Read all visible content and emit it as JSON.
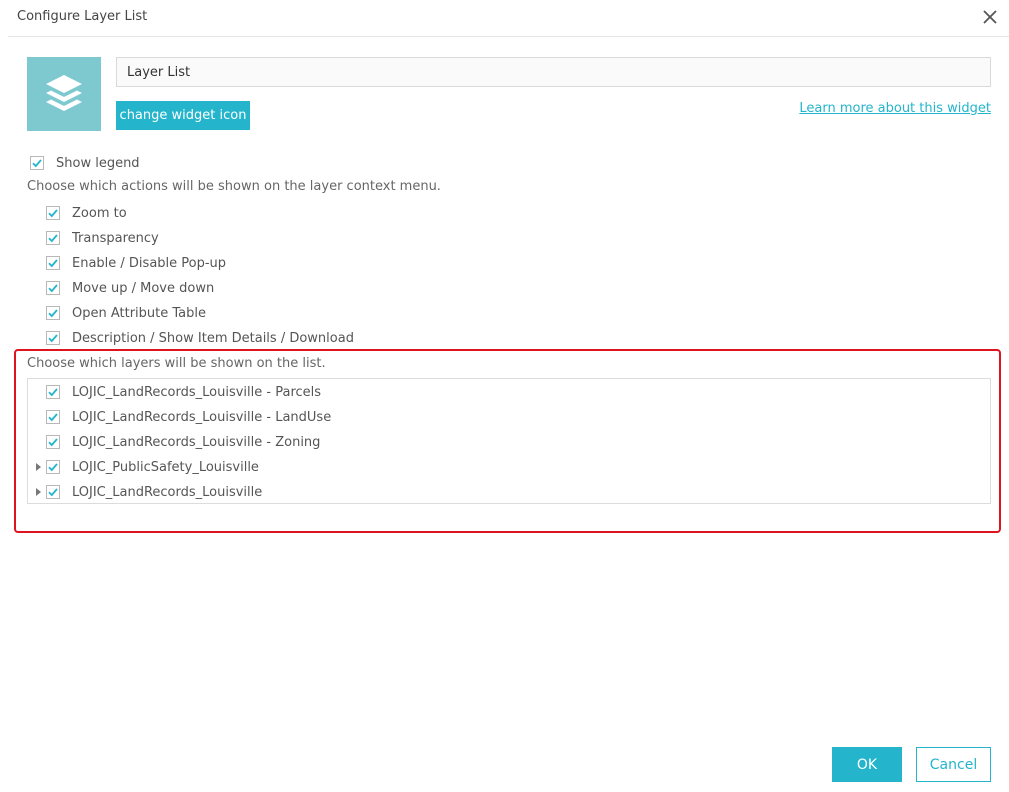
{
  "dialog": {
    "title": "Configure Layer List",
    "close_icon": "close-icon"
  },
  "widget": {
    "icon": "layers-icon",
    "name_value": "Layer List",
    "change_icon_label": "change widget icon",
    "learn_more_label": "Learn more about this widget"
  },
  "options": {
    "show_legend": {
      "label": "Show legend",
      "checked": true
    },
    "actions_heading": "Choose which actions will be shown on the layer context menu.",
    "actions": [
      {
        "label": "Zoom to",
        "checked": true
      },
      {
        "label": "Transparency",
        "checked": true
      },
      {
        "label": "Enable / Disable Pop-up",
        "checked": true
      },
      {
        "label": "Move up / Move down",
        "checked": true
      },
      {
        "label": "Open Attribute Table",
        "checked": true
      },
      {
        "label": "Description / Show Item Details / Download",
        "checked": true
      }
    ]
  },
  "layers": {
    "heading": "Choose which layers will be shown on the list.",
    "items": [
      {
        "label": "LOJIC_LandRecords_Louisville - Parcels",
        "checked": true,
        "expandable": false
      },
      {
        "label": "LOJIC_LandRecords_Louisville - LandUse",
        "checked": true,
        "expandable": false
      },
      {
        "label": "LOJIC_LandRecords_Louisville - Zoning",
        "checked": true,
        "expandable": false
      },
      {
        "label": "LOJIC_PublicSafety_Louisville",
        "checked": true,
        "expandable": true
      },
      {
        "label": "LOJIC_LandRecords_Louisville",
        "checked": true,
        "expandable": true
      }
    ]
  },
  "footer": {
    "ok_label": "OK",
    "cancel_label": "Cancel"
  },
  "colors": {
    "accent": "#24b5cc",
    "icon_tile": "#7ec8cf",
    "highlight": "#e0141e"
  }
}
